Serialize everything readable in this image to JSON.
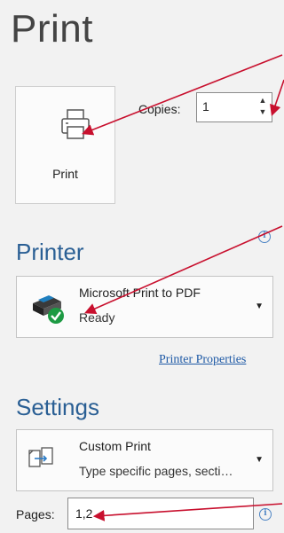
{
  "header": {
    "title": "Print"
  },
  "print_button": {
    "label": "Print",
    "icon": "printer-icon"
  },
  "copies": {
    "label": "Copies:",
    "value": "1"
  },
  "printer": {
    "heading": "Printer",
    "selected_name": "Microsoft Print to PDF",
    "status": "Ready",
    "icon": "printer-ready-icon",
    "properties_link": "Printer Properties"
  },
  "settings": {
    "heading": "Settings",
    "print_range": {
      "title": "Custom Print",
      "description": "Type specific pages, secti…",
      "icon": "custom-pages-icon"
    },
    "pages": {
      "label": "Pages:",
      "value": "1,2"
    }
  },
  "annotation_color": "#c8102e",
  "accent_color": "#2a5f94"
}
